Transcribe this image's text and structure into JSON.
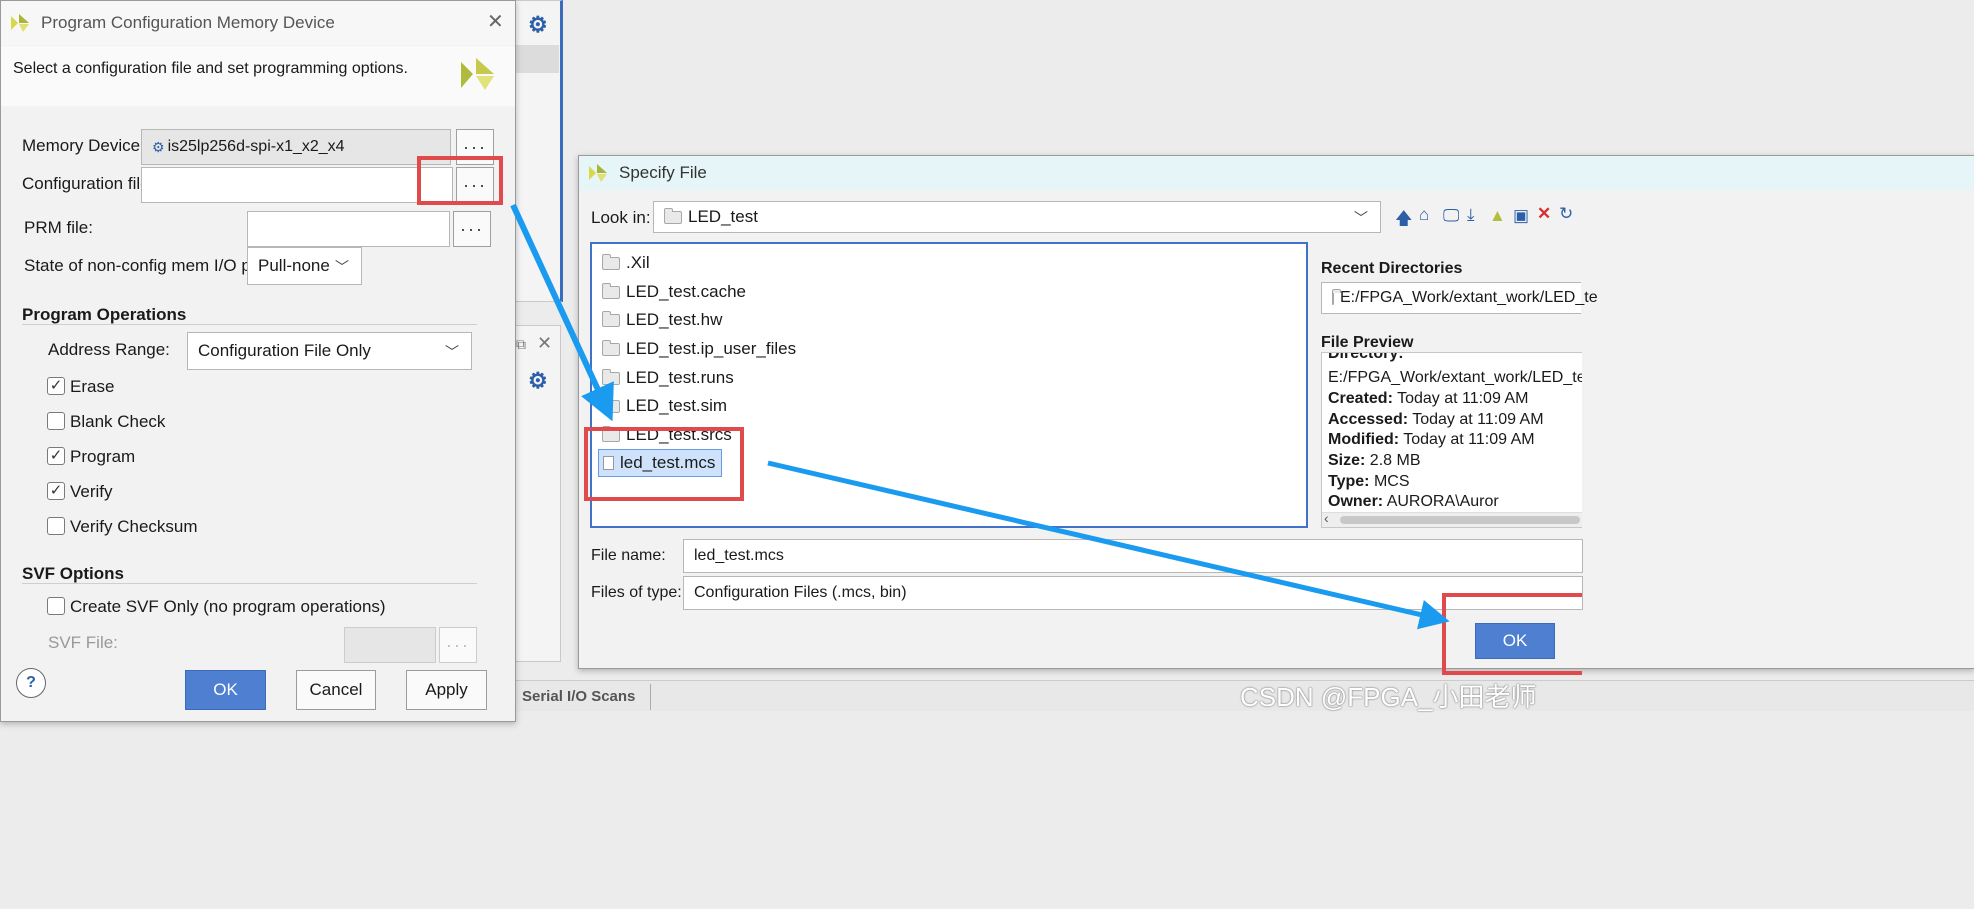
{
  "prog_dialog": {
    "title": "Program Configuration Memory Device",
    "intro": "Select a configuration file and set programming options.",
    "memory_device_label": "Memory Device:",
    "memory_device_value": "is25lp256d-spi-x1_x2_x4",
    "config_file_label": "Configuration file:",
    "config_file_value": "",
    "prm_file_label": "PRM file:",
    "state_label": "State of non-config mem I/O pins:",
    "state_value": "Pull-none",
    "program_ops_heading": "Program Operations",
    "address_range_label": "Address Range:",
    "address_range_value": "Configuration File Only",
    "ops": [
      {
        "label": "Erase",
        "checked": true
      },
      {
        "label": "Blank Check",
        "checked": false
      },
      {
        "label": "Program",
        "checked": true
      },
      {
        "label": "Verify",
        "checked": true
      },
      {
        "label": "Verify Checksum",
        "checked": false
      }
    ],
    "svf_heading": "SVF Options",
    "svf_only_label": "Create SVF Only (no program operations)",
    "svf_file_label": "SVF File:",
    "help": "?",
    "ok": "OK",
    "cancel": "Cancel",
    "apply": "Apply",
    "dots": "···"
  },
  "specify_dialog": {
    "title": "Specify File",
    "look_in_label": "Look in:",
    "look_in_value": "LED_test",
    "files": [
      ".Xil",
      "LED_test.cache",
      "LED_test.hw",
      "LED_test.ip_user_files",
      "LED_test.runs",
      "LED_test.sim",
      "LED_test.srcs"
    ],
    "selected_file": "led_test.mcs",
    "recent_heading": "Recent Directories",
    "recent_value": "E:/FPGA_Work/extant_work/LED_te",
    "preview_heading": "File Preview",
    "preview_dir_label": "Directory:",
    "preview_dir_value": "E:/FPGA_Work/extant_work/LED_test",
    "created_label": "Created:",
    "created_value": "Today at 11:09 AM",
    "accessed_label": "Accessed:",
    "accessed_value": "Today at 11:09 AM",
    "modified_label": "Modified:",
    "modified_value": "Today at 11:09 AM",
    "size_label": "Size:",
    "size_value": "2.8 MB",
    "type_label": "Type:",
    "type_value": "MCS",
    "owner_label": "Owner:",
    "owner_value": "AURORA\\Auror",
    "file_name_label": "File name:",
    "file_name_value": "led_test.mcs",
    "files_of_type_label": "Files of type:",
    "files_of_type_value": "Configuration Files (.mcs, bin)",
    "ok": "OK"
  },
  "background": {
    "status_tab": "Serial I/O Scans"
  },
  "watermark": "CSDN @FPGA_小田老师",
  "colors": {
    "accent": "#4e7fd1",
    "highlight": "#e04a4a",
    "arrow": "#1a9bf0"
  }
}
